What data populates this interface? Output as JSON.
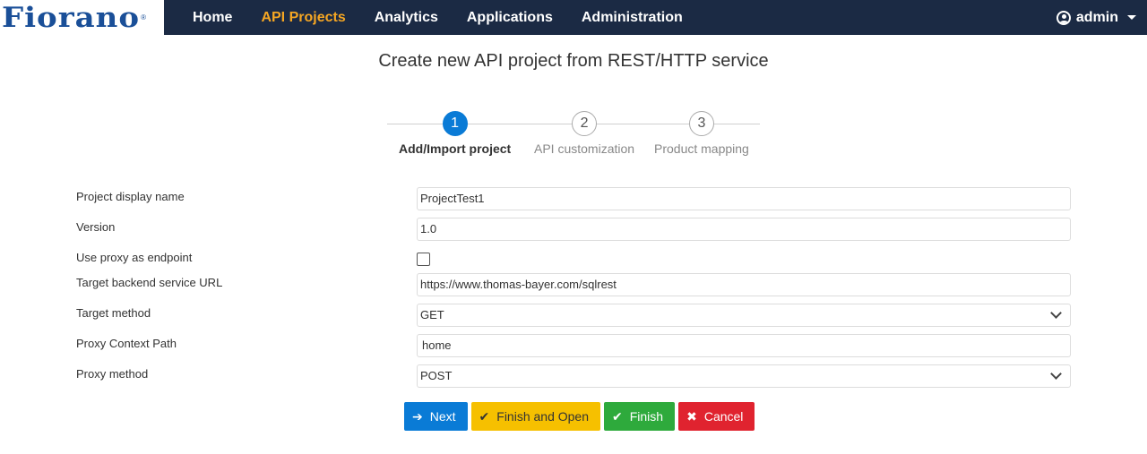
{
  "brand": {
    "logo_text": "Fiorano",
    "logo_mark": "®"
  },
  "nav": {
    "items": [
      {
        "label": "Home"
      },
      {
        "label": "API Projects"
      },
      {
        "label": "Analytics"
      },
      {
        "label": "Applications"
      },
      {
        "label": "Administration"
      }
    ],
    "active": "API Projects",
    "user": "admin"
  },
  "page": {
    "title": "Create new API project from REST/HTTP service"
  },
  "stepper": {
    "steps": [
      {
        "number": "1",
        "label": "Add/Import project"
      },
      {
        "number": "2",
        "label": "API customization"
      },
      {
        "number": "3",
        "label": "Product mapping"
      }
    ],
    "current_step": 1
  },
  "form": {
    "project_display_name": {
      "label": "Project display name",
      "value": "ProjectTest1"
    },
    "version": {
      "label": "Version",
      "value": "1.0"
    },
    "use_proxy": {
      "label": "Use proxy as endpoint",
      "checked": false
    },
    "target_url": {
      "label": "Target backend service URL",
      "value": "https://www.thomas-bayer.com/sqlrest"
    },
    "target_method": {
      "label": "Target method",
      "value": "GET"
    },
    "proxy_context_path": {
      "label": "Proxy Context Path",
      "value": "home"
    },
    "proxy_method": {
      "label": "Proxy method",
      "value": "POST"
    }
  },
  "buttons": {
    "next": "Next",
    "finish_and_open": "Finish and Open",
    "finish": "Finish",
    "cancel": "Cancel"
  },
  "colors": {
    "navbar": "#1b2a44",
    "nav_active": "#f5a623",
    "primary": "#0a7bd6",
    "warning": "#f6c000",
    "success": "#2eaa3c",
    "danger": "#e0232f"
  }
}
